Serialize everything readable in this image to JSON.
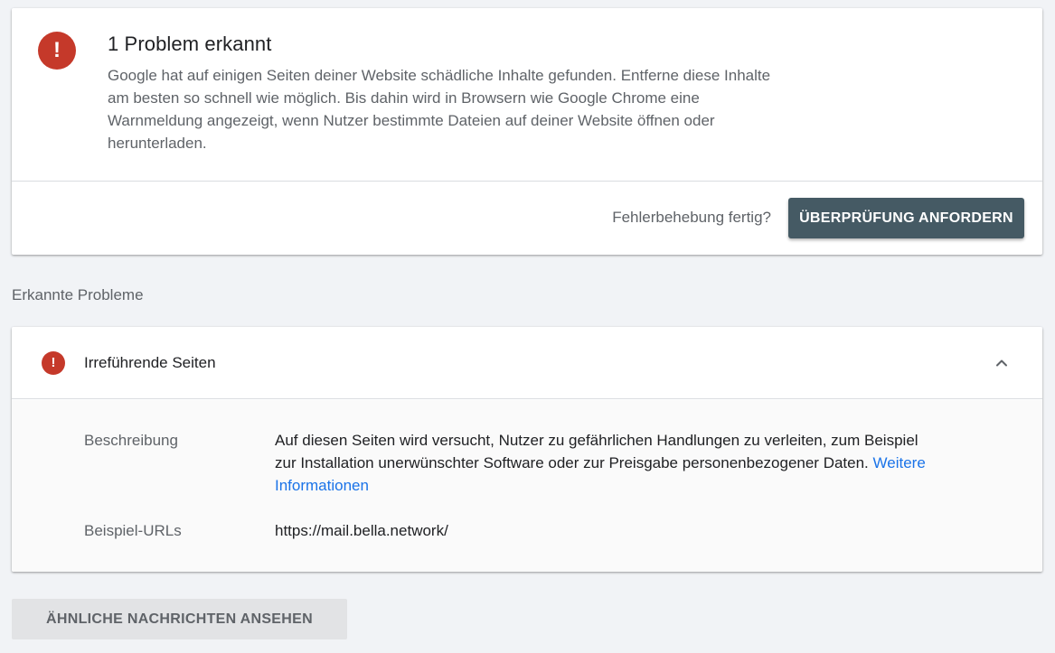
{
  "summary": {
    "icon": "error-icon",
    "icon_glyph": "!",
    "title": "1 Problem erkannt",
    "text": "Google hat auf einigen Seiten deiner Website schädliche Inhalte gefunden. Entferne diese Inhalte am besten so schnell wie möglich. Bis dahin wird in Browsern wie Google Chrome eine Warnmeldung angezeigt, wenn Nutzer bestimmte Dateien auf deiner Website öffnen oder herunterladen.",
    "fix_question": "Fehlerbehebung fertig?",
    "request_review_label": "ÜBERPRÜFUNG ANFORDERN"
  },
  "issues_section": {
    "heading": "Erkannte Probleme",
    "issue": {
      "icon": "error-icon",
      "icon_glyph": "!",
      "title": "Irreführende Seiten",
      "toggle_icon": "chevron-up-icon",
      "description_label": "Beschreibung",
      "description_text": "Auf diesen Seiten wird versucht, Nutzer zu gefährlichen Handlungen zu verleiten, zum Beispiel zur Installation unerwünschter Software oder zur Preisgabe personenbezogener Daten.",
      "description_link": "Weitere Informationen",
      "urls_label": "Beispiel-URLs",
      "example_url": "https://mail.bella.network/"
    }
  },
  "similar_messages_label": "ÄHNLICHE NACHRICHTEN ANSEHEN",
  "colors": {
    "error_red": "#c5392a",
    "primary_button": "#455a64",
    "link_blue": "#1a73e8",
    "page_background": "#f1f3f6"
  }
}
